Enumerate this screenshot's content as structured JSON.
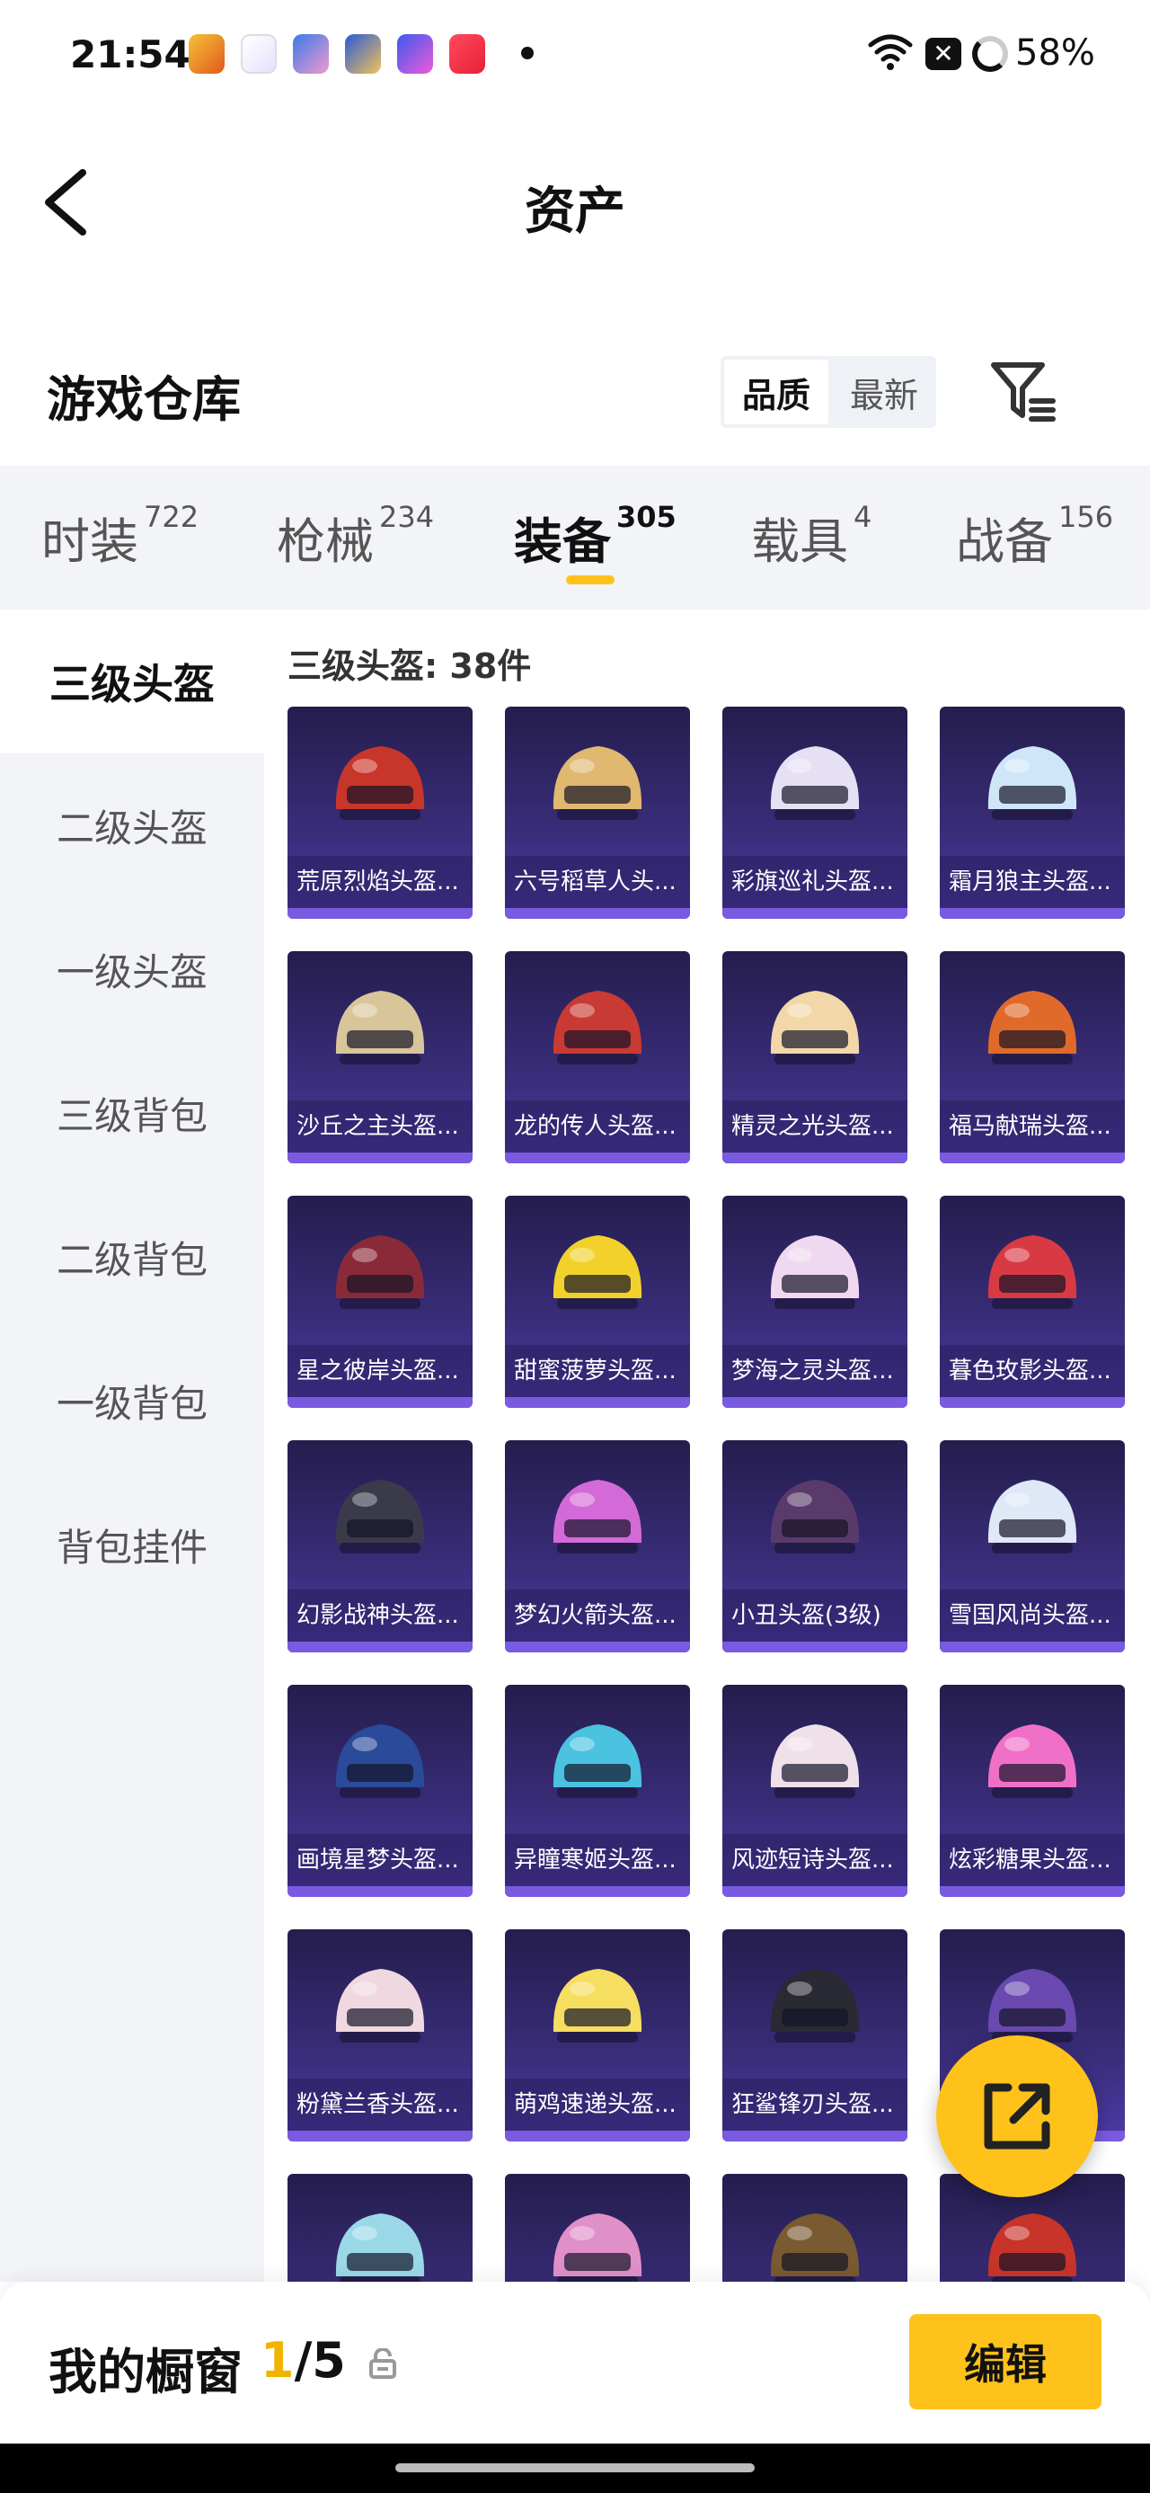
{
  "status_bar": {
    "time": "21:54",
    "battery": "58%",
    "sim_glyph": "✕",
    "app_icons": [
      "game-app-icon",
      "puzzle-app-icon",
      "character-app-icon",
      "avatar-app-icon",
      "star-app-icon",
      "music-app-icon"
    ]
  },
  "header": {
    "title": "资产"
  },
  "warehouse": {
    "title": "游戏仓库",
    "sort_options": [
      "品质",
      "最新"
    ],
    "active_sort": "品质"
  },
  "tabs": [
    {
      "label": "时装",
      "count": "722"
    },
    {
      "label": "枪械",
      "count": "234"
    },
    {
      "label": "装备",
      "count": "305",
      "active": true
    },
    {
      "label": "载具",
      "count": "4"
    },
    {
      "label": "战备",
      "count": "156"
    }
  ],
  "sidebar": {
    "items": [
      "三级头盔",
      "二级头盔",
      "一级头盔",
      "三级背包",
      "二级背包",
      "一级背包",
      "背包挂件"
    ],
    "active_index": 0
  },
  "grid": {
    "heading": "三级头盔: 38件",
    "items": [
      {
        "label": "荒原烈焰头盔...",
        "color": "#c8352a"
      },
      {
        "label": "六号稻草人头...",
        "color": "#e0b870"
      },
      {
        "label": "彩旗巡礼头盔...",
        "color": "#e6e0f5"
      },
      {
        "label": "霜月狼主头盔...",
        "color": "#cfe6f8"
      },
      {
        "label": "沙丘之主头盔...",
        "color": "#d9c59a"
      },
      {
        "label": "龙的传人头盔...",
        "color": "#c93a34"
      },
      {
        "label": "精灵之光头盔...",
        "color": "#f2d7a8"
      },
      {
        "label": "福马献瑞头盔...",
        "color": "#e06a2a"
      },
      {
        "label": "星之彼岸头盔...",
        "color": "#8a2a38"
      },
      {
        "label": "甜蜜菠萝头盔...",
        "color": "#f2d22a"
      },
      {
        "label": "梦海之灵头盔...",
        "color": "#f0d8f0"
      },
      {
        "label": "暮色玫影头盔...",
        "color": "#d83a44"
      },
      {
        "label": "幻影战神头盔...",
        "color": "#3a3a4a"
      },
      {
        "label": "梦幻火箭头盔...",
        "color": "#d46ad8"
      },
      {
        "label": "小丑头盔(3级)",
        "color": "#5a3a6a"
      },
      {
        "label": "雪国风尚头盔...",
        "color": "#dfe8f6"
      },
      {
        "label": "画境星梦头盔...",
        "color": "#2a4a9a"
      },
      {
        "label": "异瞳寒姬头盔...",
        "color": "#4ac2e0"
      },
      {
        "label": "风迹短诗头盔...",
        "color": "#f0e0ea"
      },
      {
        "label": "炫彩糖果头盔...",
        "color": "#f070c8"
      },
      {
        "label": "粉黛兰香头盔...",
        "color": "#f0d8e0"
      },
      {
        "label": "萌鸡速递头盔...",
        "color": "#f6de60"
      },
      {
        "label": "狂鲨锋刃头盔...",
        "color": "#2a2a34"
      },
      {
        "label": "",
        "color": "#6a4ab0"
      },
      {
        "label": "",
        "color": "#9ad8e8"
      },
      {
        "label": "",
        "color": "#e090c8"
      },
      {
        "label": "",
        "color": "#7a5a30"
      },
      {
        "label": "",
        "color": "#c8342a"
      }
    ]
  },
  "showcase": {
    "label": "我的橱窗",
    "current": "1",
    "total": "/5",
    "edit_label": "编辑"
  }
}
